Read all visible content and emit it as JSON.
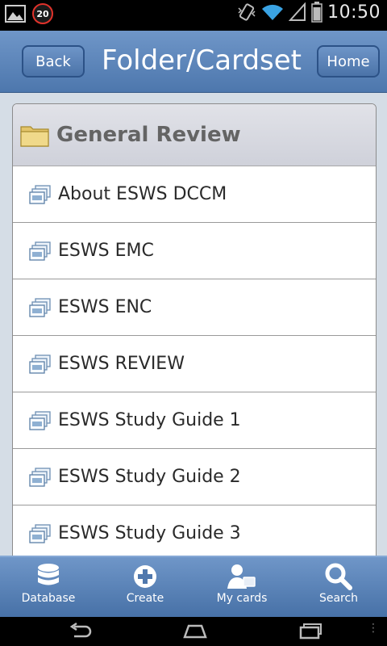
{
  "status_bar": {
    "notification_count": "20",
    "time": "10:50"
  },
  "header": {
    "back_label": "Back",
    "title": "Folder/Cardset",
    "home_label": "Home"
  },
  "folder": {
    "title": "General Review"
  },
  "cardsets": [
    {
      "label": "About ESWS DCCM"
    },
    {
      "label": "ESWS EMC"
    },
    {
      "label": "ESWS ENC"
    },
    {
      "label": "ESWS REVIEW"
    },
    {
      "label": "ESWS Study Guide 1"
    },
    {
      "label": "ESWS Study Guide 2"
    },
    {
      "label": "ESWS Study Guide 3"
    }
  ],
  "tabs": {
    "database": "Database",
    "create": "Create",
    "my_cards": "My cards",
    "search": "Search"
  },
  "colors": {
    "header_blue": "#5a83b9",
    "folder_header_bg": "#d6d8e0",
    "status_bar": "#000000"
  },
  "icons": [
    "gallery-icon",
    "notification-badge-icon",
    "vibrate-icon",
    "wifi-icon",
    "signal-icon",
    "battery-icon",
    "folder-icon",
    "cardset-icon",
    "database-icon",
    "plus-icon",
    "my-cards-icon",
    "search-icon",
    "nav-back-icon",
    "nav-home-icon",
    "nav-recents-icon"
  ]
}
